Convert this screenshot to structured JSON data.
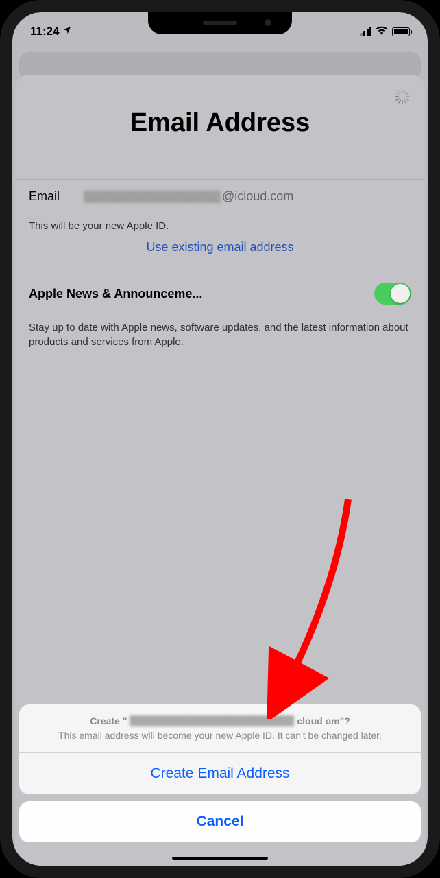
{
  "statusbar": {
    "time": "11:24"
  },
  "page": {
    "title": "Email Address"
  },
  "emailRow": {
    "label": "Email",
    "suffix": "@icloud.com"
  },
  "footnote": "This will be your new Apple ID.",
  "useExistingLink": "Use existing email address",
  "toggleRow": {
    "label": "Apple News & Announceme..."
  },
  "description": "Stay up to date with Apple news, software updates, and the latest information about products and services from Apple.",
  "actionSheet": {
    "titlePrefix": "Create \"",
    "titleSuffix": "cloud   om\"?",
    "subtitle": "This email address will become your new Apple ID. It can't be changed later.",
    "createButton": "Create Email Address",
    "cancelButton": "Cancel"
  }
}
